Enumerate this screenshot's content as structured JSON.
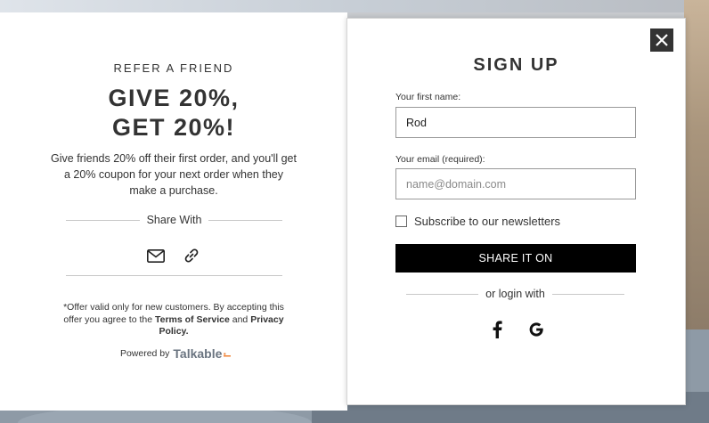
{
  "left": {
    "refer_label": "REFER A FRIEND",
    "headline_line1": "GIVE 20%,",
    "headline_line2": "GET 20%!",
    "description": "Give friends 20% off their first order, and you'll get a  20% coupon for your next order when they make a purchase.",
    "share_with": "Share With",
    "share_icons": [
      "mail-icon",
      "link-icon"
    ],
    "offer_text_1": "*Offer valid only for new customers. By accepting this offer you agree to the ",
    "terms_link": "Terms of Service",
    "offer_and": " and ",
    "privacy_link": "Privacy Policy.",
    "powered_by": "Powered by",
    "brand": "Talkable"
  },
  "right": {
    "title": "SIGN UP",
    "first_name_label": "Your first name:",
    "first_name_value": "Rod",
    "email_label": "Your email (required):",
    "email_placeholder": "name@domain.com",
    "subscribe_label": "Subscribe to our newsletters",
    "subscribe_checked": false,
    "share_button": "SHARE IT ON",
    "or_login_with": "or login with",
    "social_icons": [
      "facebook-icon",
      "google-icon"
    ],
    "close_icon": "close-icon"
  },
  "colors": {
    "primary_button": "#000000",
    "text": "#333333",
    "brand_accent": "#ef7d2c"
  }
}
